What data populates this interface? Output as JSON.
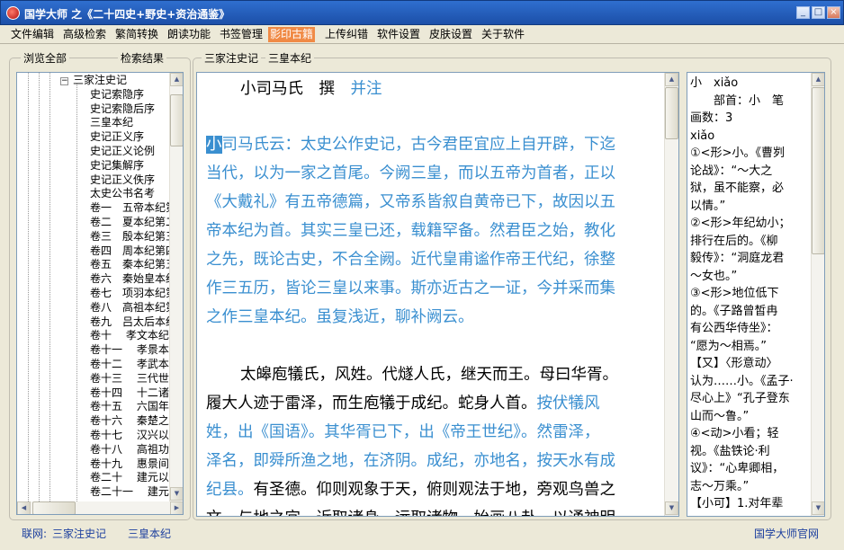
{
  "window": {
    "title": "国学大师 之《二十四史+野史+资治通鉴》",
    "min": "_",
    "max": "□",
    "close": "×"
  },
  "menu": [
    "文件编辑",
    "高级检索",
    "繁简转换",
    "朗读功能",
    "书签管理",
    "影印古籍",
    "上传纠错",
    "软件设置",
    "皮肤设置",
    "关于软件"
  ],
  "menu_active": "影印古籍",
  "left_panel": {
    "tab_browse": "浏览全部",
    "tab_search": "检索结果"
  },
  "tree": {
    "root": "三家注史记",
    "items": [
      "史记索隐序",
      "史记索隐后序",
      "三皇本纪",
      "史记正义序",
      "史记正义论例",
      "史记集解序",
      "史记正义佚序",
      "太史公书名考",
      "卷一　五帝本纪第",
      "卷二　夏本纪第二",
      "卷三　殷本纪第三",
      "卷四　周本纪第四",
      "卷五　秦本纪第五",
      "卷六　秦始皇本纪",
      "卷七　项羽本纪第",
      "卷八　高祖本纪第",
      "卷九　吕太后本纪",
      "卷十　 孝文本纪",
      "卷十一　 孝景本",
      "卷十二　 孝武本",
      "卷十三　 三代世",
      "卷十四　 十二诸",
      "卷十五　 六国年",
      "卷十六　 秦楚之",
      "卷十七　 汉兴以",
      "卷十八　 高祖功",
      "卷十九　 惠景间",
      "卷二十　 建元以来",
      "卷二十一　 建元已"
    ]
  },
  "breadcrumb": {
    "book": "三家注史记",
    "chapter": "三皇本纪"
  },
  "reader": {
    "heading_author": "小司马氏",
    "heading_verb": "撰",
    "heading_note": "并注",
    "note_first_char": "小",
    "note_lines": [
      "司马氏云：太史公作史记，古今君臣宜应上自开辟，下迄",
      "当代，以为一家之首尾。今阙三皇，而以五帝为首者，正以",
      "《大戴礼》有五帝德篇，又帝系皆叙自黄帝已下，故因以五",
      "帝本纪为首。其实三皇已还，载籍罕备。然君臣之始，教化",
      "之先，既论古史，不合全阙。近代皇甫谧作帝王代纪，徐整",
      "作三五历，皆论三皇以来事。斯亦近古之一证，今并采而集",
      "之作三皇本纪。虽复浅近，聊补阙云。"
    ],
    "p2_line1": "太皞庖犠氏，风姓。代燧人氏，继天而王。母曰华胥。",
    "p2_line2_black": "履大人迹于雷泽，而生庖犠于成纪。蛇身人首。",
    "p2_line2_blue": "按伏犠风",
    "p2_blue_lines": [
      "姓，出《国语》。其华胥已下，出《帝王世纪》。然雷泽，",
      "泽名，即舜所渔之地，在济阴。成纪，亦地名，按天水有成"
    ],
    "p2_line5_blue": "纪县。",
    "p2_line5_black": "有圣德。仰则观象于天，俯则观法于地，旁观鸟兽之",
    "p2_line6_partial": "文，与地之宜，近取诸身，远取诸物，始画八卦，以通神明"
  },
  "dict": {
    "lines": [
      "小　xiǎo",
      "　　部首：小　笔",
      "画数：3",
      "xiǎo",
      "①<形>小。《曹刿",
      "论战》：“～大之",
      "狱，虽不能察，必",
      "以情。”",
      "②<形>年纪幼小；",
      "排行在后的。《柳",
      "毅传》：“洞庭龙君",
      "～女也。”",
      "③<形>地位低下",
      "的。《子路曾皙冉",
      "有公西华侍坐》：",
      "“愿为～相焉。”",
      "【又】〈形意动〉",
      "认为……小。《孟子·",
      "尽心上》“孔子登东",
      "山而～鲁。”",
      "④<动>小看；轻",
      "视。《盐铁论·利",
      "议》：“心卑卿相，",
      "志～万乘。”",
      "【小可】1.对年辈"
    ]
  },
  "status": {
    "prefix": "联网:",
    "book": "三家注史记",
    "chapter": "三皇本纪",
    "site": "国学大师官网"
  }
}
